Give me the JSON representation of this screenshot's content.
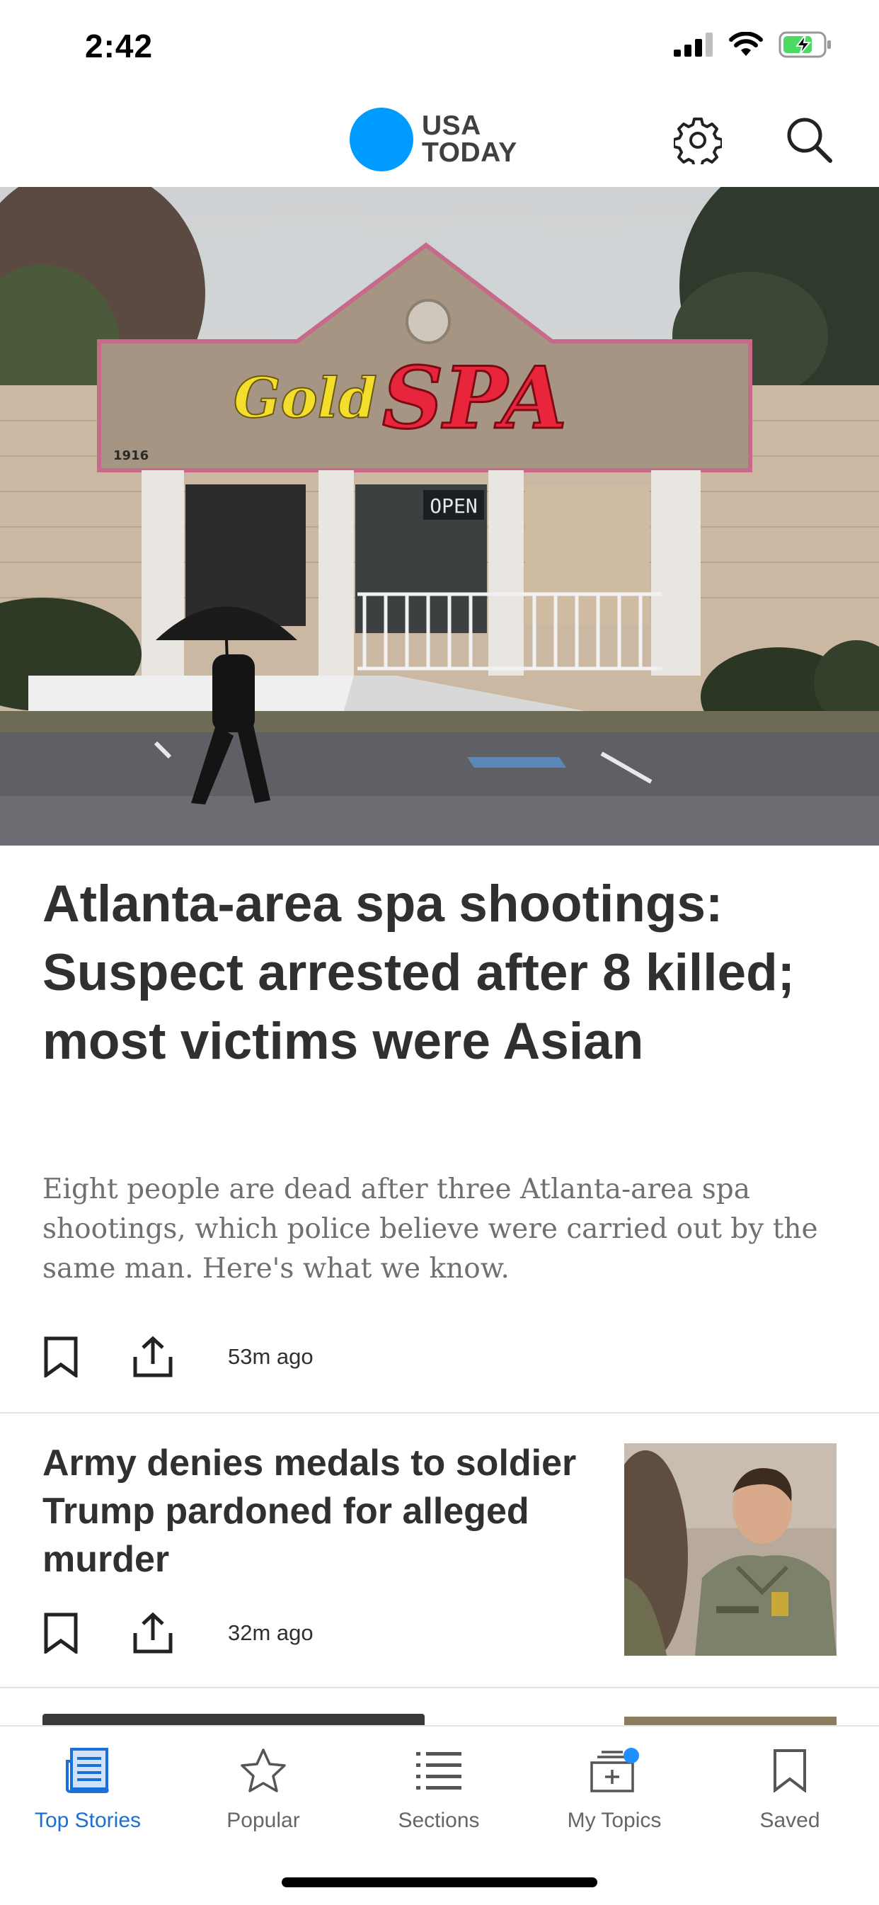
{
  "status_bar": {
    "time": "2:42"
  },
  "header": {
    "logo_line1": "USA",
    "logo_line2": "TODAY",
    "brand_color": "#009bff",
    "settings_icon": "gear-icon",
    "search_icon": "search-icon"
  },
  "top_story": {
    "image_sign_left": "Gold",
    "image_sign_right": "SPA",
    "image_open_sign": "OPEN",
    "image_address": "1916",
    "headline": "Atlanta-area spa shootings: Suspect arrested after 8 killed; most victims were Asian",
    "summary": "Eight people are dead after three Atlanta-area spa shootings, which police believe were carried out by the same man. Here's what we know.",
    "time_ago": "53m ago"
  },
  "stories": [
    {
      "headline": "Army denies medals to soldier Trump pardoned for alleged murder",
      "time_ago": "32m ago"
    }
  ],
  "tab_bar": {
    "active_color": "#1a6fd8",
    "items": [
      {
        "label": "Top Stories",
        "icon": "newspaper-icon",
        "active": true
      },
      {
        "label": "Popular",
        "icon": "star-icon",
        "active": false
      },
      {
        "label": "Sections",
        "icon": "list-icon",
        "active": false
      },
      {
        "label": "My Topics",
        "icon": "topics-icon",
        "active": false
      },
      {
        "label": "Saved",
        "icon": "bookmark-icon",
        "active": false
      }
    ]
  }
}
